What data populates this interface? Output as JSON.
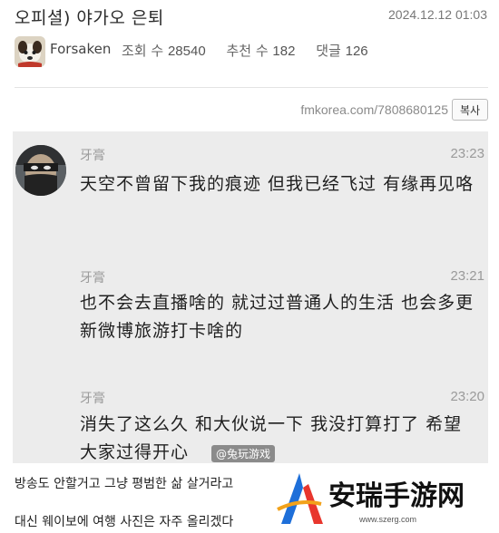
{
  "post": {
    "title": "오피셜) 야가오 은퇴",
    "date": "2024.12.12 01:03",
    "author": "Forsaken",
    "views_label": "조회 수",
    "views": "28540",
    "recommend_label": "추천 수",
    "recommend": "182",
    "comments_label": "댓글",
    "comments": "126",
    "url": "fmkorea.com/7808680125",
    "copy_label": "복사"
  },
  "chat": {
    "messages": [
      {
        "name": "牙膏",
        "time": "23:23",
        "text": "天空不曾留下我的痕迹 但我已经飞过 有缘再见咯"
      },
      {
        "name": "牙膏",
        "time": "23:21",
        "text": "也不会去直播啥的 就过过普通人的生活 也会多更新微博旅游打卡啥的"
      },
      {
        "name": "牙膏",
        "time": "23:20",
        "text": "消失了这么久 和大伙说一下 我没打算打了 希望大家过得开心"
      }
    ]
  },
  "body": {
    "line1": "방송도 안할거고 그냥 평범한 삶 살거라고",
    "line2": "대신 웨이보에 여행 사진은 자주 올리겠다"
  },
  "watermarks": {
    "weibo": "@兔玩游戏",
    "site_brand": "安瑞手游网",
    "site_url": "www.szerg.com"
  }
}
